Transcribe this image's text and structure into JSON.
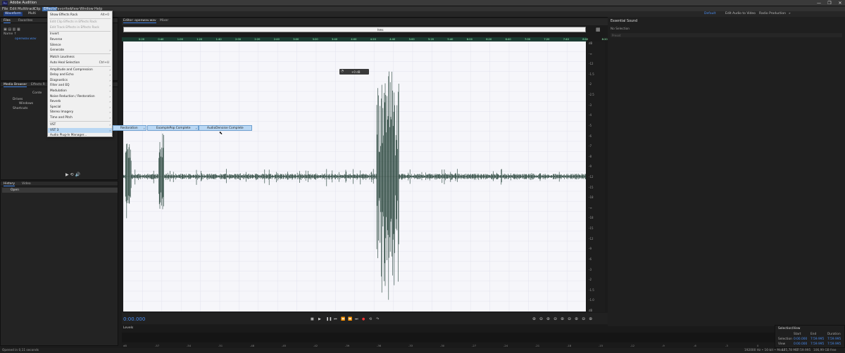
{
  "app": {
    "title": "Adobe Audition",
    "logo": "Au"
  },
  "window_controls": {
    "minimize": "—",
    "maximize": "❐",
    "close": "✕"
  },
  "menubar": [
    "File",
    "Edit",
    "Multitrack",
    "Clip",
    "Effects",
    "Favorites",
    "View",
    "Window",
    "Help"
  ],
  "toolbar": {
    "waveform": "Waveform",
    "multitrack": "Multi",
    "workspaces": [
      "Default",
      "Edit Audio to Video",
      "Radio Production"
    ],
    "more": "»"
  },
  "files_panel": {
    "tabs": [
      "Files",
      "Favorites"
    ],
    "column": "Name ↑",
    "file": "openwav.wav"
  },
  "media_browser": {
    "tabs": [
      "Media Browser",
      "Effects R"
    ],
    "content_label": "Conte",
    "items": [
      "Drives",
      "Windows",
      "Shortcuts"
    ]
  },
  "history_panel": {
    "tabs": [
      "History",
      "Video"
    ],
    "item": "Open"
  },
  "editor": {
    "tabs": [
      "Editor: openwav.wav",
      "Mixer"
    ],
    "overview_label": "hms",
    "time": "0:00.000",
    "hud_value": "+0 dB",
    "ruler_marks": [
      "0:20",
      "0:40",
      "1:00",
      "1:20",
      "1:40",
      "2:00",
      "2:20",
      "2:40",
      "3:00",
      "3:20",
      "3:40",
      "4:00",
      "4:20",
      "4:40",
      "5:00",
      "5:20",
      "5:40",
      "6:00",
      "6:20",
      "6:40",
      "7:00",
      "7:20",
      "7:40",
      "8:00",
      "8:20",
      "8:40",
      "9:00",
      "9:20",
      "9:40"
    ],
    "scale": [
      "dB",
      "-∞",
      "-12",
      "-1.5",
      "-2",
      "-2.5",
      "-3",
      "-4",
      "-5",
      "-6",
      "-7",
      "-8",
      "-9",
      "-12",
      "-15",
      "-18",
      "-∞",
      "-18",
      "-15",
      "-12",
      "-9",
      "-6",
      "-3",
      "-2",
      "-1.5",
      "-1.0",
      "dB"
    ]
  },
  "effects_menu": {
    "items": [
      {
        "label": "Show Effects Rack",
        "shortcut": "Alt+0"
      },
      {
        "label": "Edit Clip Effects in Effects Rack",
        "disabled": true
      },
      {
        "label": "Edit Track Effects in Effects Rack",
        "disabled": true
      },
      {
        "label": "Invert"
      },
      {
        "label": "Reverse"
      },
      {
        "label": "Silence"
      },
      {
        "label": "Generate",
        "arrow": "›"
      },
      {
        "label": "Match Loudness"
      },
      {
        "label": "Auto Heal Selection",
        "shortcut": "Ctrl+U"
      },
      {
        "label": "Amplitude and Compression",
        "arrow": "›"
      },
      {
        "label": "Delay and Echo",
        "arrow": "›"
      },
      {
        "label": "Diagnostics",
        "arrow": "›"
      },
      {
        "label": "Filter and EQ",
        "arrow": "›"
      },
      {
        "label": "Modulation",
        "arrow": "›"
      },
      {
        "label": "Noise Reduction / Restoration",
        "arrow": "›"
      },
      {
        "label": "Reverb",
        "arrow": "›"
      },
      {
        "label": "Special",
        "arrow": "›"
      },
      {
        "label": "Stereo Imagery",
        "arrow": "›"
      },
      {
        "label": "Time and Pitch",
        "arrow": "›"
      },
      {
        "label": "VST",
        "arrow": "›"
      },
      {
        "label": "VST 3",
        "arrow": "›",
        "highlighted": true
      },
      {
        "label": "Audio Plug-In Manager..."
      }
    ],
    "submenu_chain": [
      "Restoration",
      "ExamplePop Complete",
      "AudioDenoise Complete"
    ]
  },
  "right_panel": {
    "title": "Essential Sound",
    "subtitle": "No Selection",
    "preset_label": "Preset"
  },
  "levels_panel": {
    "title": "Levels",
    "scale": [
      "dB",
      "-57",
      "-54",
      "-51",
      "-48",
      "-45",
      "-42",
      "-39",
      "-36",
      "-33",
      "-30",
      "-27",
      "-24",
      "-21",
      "-18",
      "-15",
      "-12",
      "-9",
      "-6",
      "-3",
      "0"
    ]
  },
  "selection_view": {
    "title": "Selection/View",
    "headers": [
      "Start",
      "End",
      "Duration"
    ],
    "rows": [
      {
        "label": "Selection",
        "start": "0:00.000",
        "end": "7:59.995",
        "duration": "7:59.995"
      },
      {
        "label": "View",
        "start": "0:00.000",
        "end": "7:59.995",
        "duration": "7:59.995"
      }
    ]
  },
  "statusbar": {
    "left": "Opened in 0,11 seconds",
    "info": [
      "192000 Hz • 16-bit • Mono",
      "175,78 MB",
      "7:59.995",
      "106,99 GB free"
    ]
  },
  "colors": {
    "accent": "#3b7de0",
    "waveform": "#1f3d33",
    "menu_highlight": "#b9d7f3"
  }
}
